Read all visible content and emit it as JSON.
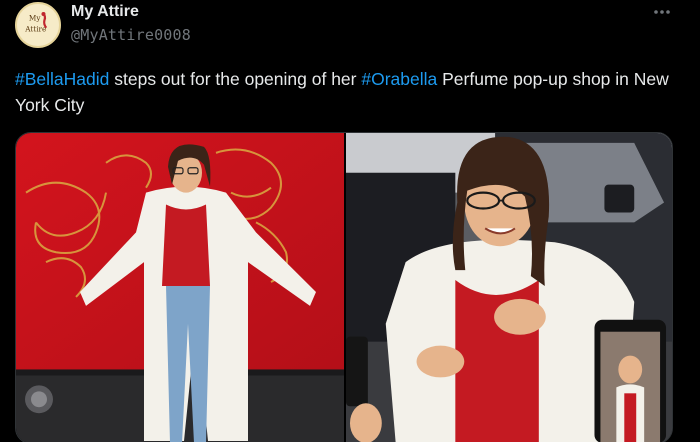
{
  "post": {
    "display_name": "My Attire",
    "handle": "@MyAttire0008",
    "avatar_text_line1": "My",
    "avatar_text_line2": "Attire",
    "text": {
      "hashtag1": "#BellaHadid",
      "part1": " steps out for the opening of her ",
      "hashtag2": "#Orabella",
      "part2": " Perfume pop-up shop in New York City"
    }
  },
  "icons": {
    "more": "more-horizontal-icon"
  },
  "colors": {
    "background": "#000000",
    "text": "#e7e9ea",
    "muted": "#71767b",
    "hashtag": "#1d9bf0",
    "border": "#2f3336"
  }
}
